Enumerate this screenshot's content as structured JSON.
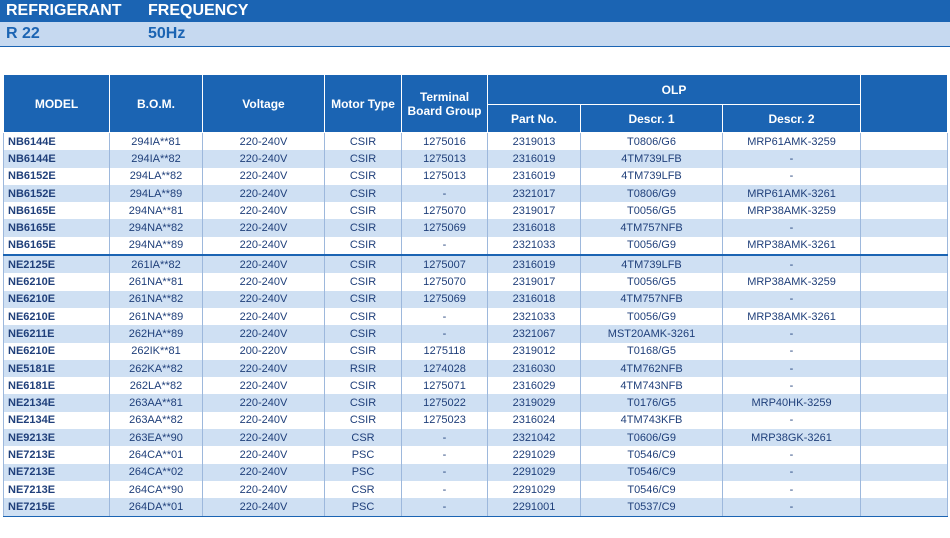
{
  "banner": {
    "label1": "REFRIGERANT",
    "label2": "FREQUENCY",
    "value1": "R 22",
    "value2": "50Hz"
  },
  "headers": {
    "model": "MODEL",
    "bom": "B.O.M.",
    "voltage": "Voltage",
    "motor_type": "Motor Type",
    "terminal_line1": "Terminal",
    "terminal_line2": "Board Group",
    "olp": "OLP",
    "part_no": "Part No.",
    "descr1": "Descr. 1",
    "descr2": "Descr. 2"
  },
  "rows": [
    {
      "model": "NB6144E",
      "bom": "294IA**81",
      "voltage": "220-240V",
      "motor": "CSIR",
      "terminal": "1275016",
      "part": "2319013",
      "d1": "T0806/G6",
      "d2": "MRP61AMK-3259"
    },
    {
      "model": "NB6144E",
      "bom": "294IA**82",
      "voltage": "220-240V",
      "motor": "CSIR",
      "terminal": "1275013",
      "part": "2316019",
      "d1": "4TM739LFB",
      "d2": "-"
    },
    {
      "model": "NB6152E",
      "bom": "294LA**82",
      "voltage": "220-240V",
      "motor": "CSIR",
      "terminal": "1275013",
      "part": "2316019",
      "d1": "4TM739LFB",
      "d2": "-"
    },
    {
      "model": "NB6152E",
      "bom": "294LA**89",
      "voltage": "220-240V",
      "motor": "CSIR",
      "terminal": "-",
      "part": "2321017",
      "d1": "T0806/G9",
      "d2": "MRP61AMK-3261"
    },
    {
      "model": "NB6165E",
      "bom": "294NA**81",
      "voltage": "220-240V",
      "motor": "CSIR",
      "terminal": "1275070",
      "part": "2319017",
      "d1": "T0056/G5",
      "d2": "MRP38AMK-3259"
    },
    {
      "model": "NB6165E",
      "bom": "294NA**82",
      "voltage": "220-240V",
      "motor": "CSIR",
      "terminal": "1275069",
      "part": "2316018",
      "d1": "4TM757NFB",
      "d2": "-"
    },
    {
      "model": "NB6165E",
      "bom": "294NA**89",
      "voltage": "220-240V",
      "motor": "CSIR",
      "terminal": "-",
      "part": "2321033",
      "d1": "T0056/G9",
      "d2": "MRP38AMK-3261"
    },
    {
      "model": "NE2125E",
      "bom": "261IA**82",
      "voltage": "220-240V",
      "motor": "CSIR",
      "terminal": "1275007",
      "part": "2316019",
      "d1": "4TM739LFB",
      "d2": "-",
      "sep": true
    },
    {
      "model": "NE6210E",
      "bom": "261NA**81",
      "voltage": "220-240V",
      "motor": "CSIR",
      "terminal": "1275070",
      "part": "2319017",
      "d1": "T0056/G5",
      "d2": "MRP38AMK-3259"
    },
    {
      "model": "NE6210E",
      "bom": "261NA**82",
      "voltage": "220-240V",
      "motor": "CSIR",
      "terminal": "1275069",
      "part": "2316018",
      "d1": "4TM757NFB",
      "d2": "-"
    },
    {
      "model": "NE6210E",
      "bom": "261NA**89",
      "voltage": "220-240V",
      "motor": "CSIR",
      "terminal": "-",
      "part": "2321033",
      "d1": "T0056/G9",
      "d2": "MRP38AMK-3261"
    },
    {
      "model": "NE6211E",
      "bom": "262HA**89",
      "voltage": "220-240V",
      "motor": "CSIR",
      "terminal": "-",
      "part": "2321067",
      "d1": "MST20AMK-3261",
      "d2": "-"
    },
    {
      "model": "NE6210E",
      "bom": "262IK**81",
      "voltage": "200-220V",
      "motor": "CSIR",
      "terminal": "1275118",
      "part": "2319012",
      "d1": "T0168/G5",
      "d2": "-"
    },
    {
      "model": "NE5181E",
      "bom": "262KA**82",
      "voltage": "220-240V",
      "motor": "RSIR",
      "terminal": "1274028",
      "part": "2316030",
      "d1": "4TM762NFB",
      "d2": "-"
    },
    {
      "model": "NE6181E",
      "bom": "262LA**82",
      "voltage": "220-240V",
      "motor": "CSIR",
      "terminal": "1275071",
      "part": "2316029",
      "d1": "4TM743NFB",
      "d2": "-"
    },
    {
      "model": "NE2134E",
      "bom": "263AA**81",
      "voltage": "220-240V",
      "motor": "CSIR",
      "terminal": "1275022",
      "part": "2319029",
      "d1": "T0176/G5",
      "d2": "MRP40HK-3259"
    },
    {
      "model": "NE2134E",
      "bom": "263AA**82",
      "voltage": "220-240V",
      "motor": "CSIR",
      "terminal": "1275023",
      "part": "2316024",
      "d1": "4TM743KFB",
      "d2": "-"
    },
    {
      "model": "NE9213E",
      "bom": "263EA**90",
      "voltage": "220-240V",
      "motor": "CSR",
      "terminal": "-",
      "part": "2321042",
      "d1": "T0606/G9",
      "d2": "MRP38GK-3261"
    },
    {
      "model": "NE7213E",
      "bom": "264CA**01",
      "voltage": "220-240V",
      "motor": "PSC",
      "terminal": "-",
      "part": "2291029",
      "d1": "T0546/C9",
      "d2": "-"
    },
    {
      "model": "NE7213E",
      "bom": "264CA**02",
      "voltage": "220-240V",
      "motor": "PSC",
      "terminal": "-",
      "part": "2291029",
      "d1": "T0546/C9",
      "d2": "-"
    },
    {
      "model": "NE7213E",
      "bom": "264CA**90",
      "voltage": "220-240V",
      "motor": "CSR",
      "terminal": "-",
      "part": "2291029",
      "d1": "T0546/C9",
      "d2": "-"
    },
    {
      "model": "NE7215E",
      "bom": "264DA**01",
      "voltage": "220-240V",
      "motor": "PSC",
      "terminal": "-",
      "part": "2291001",
      "d1": "T0537/C9",
      "d2": "-"
    }
  ],
  "colors": {
    "header_blue": "#1b64b3",
    "stripe": "#cfe0f3",
    "text": "#1f3f7a"
  }
}
